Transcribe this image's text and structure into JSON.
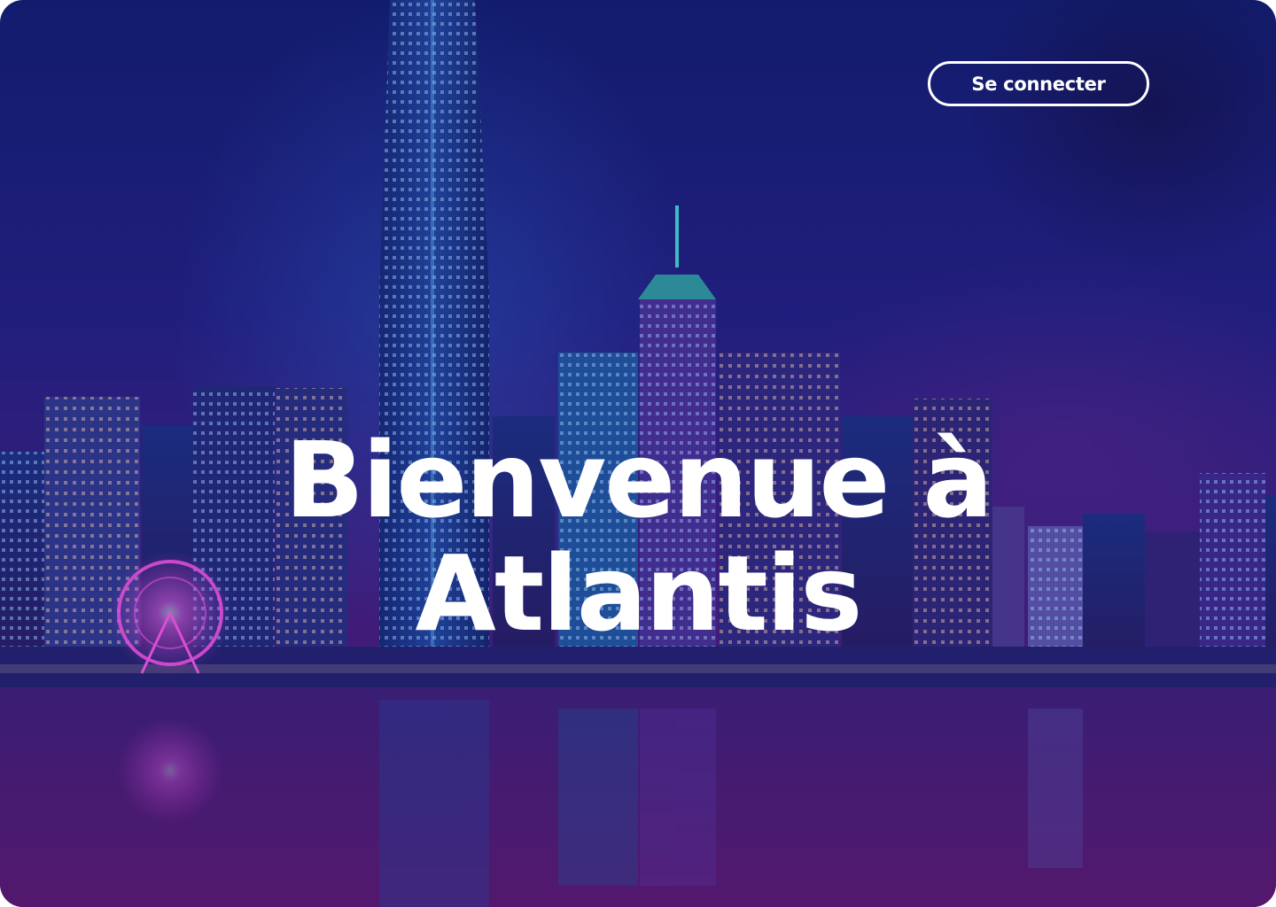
{
  "header": {
    "login_label": "Se connecter"
  },
  "hero": {
    "title_line1": "Bienvenue à",
    "title_line2": "Atlantis"
  },
  "background": {
    "image": "night-city-skyline"
  },
  "colors": {
    "text": "#ffffff",
    "sky_top": "#0a1d66",
    "sky_bottom": "#6a1a6e",
    "accent_pink": "#ff3cd8",
    "accent_cyan": "#3fe0d0"
  }
}
